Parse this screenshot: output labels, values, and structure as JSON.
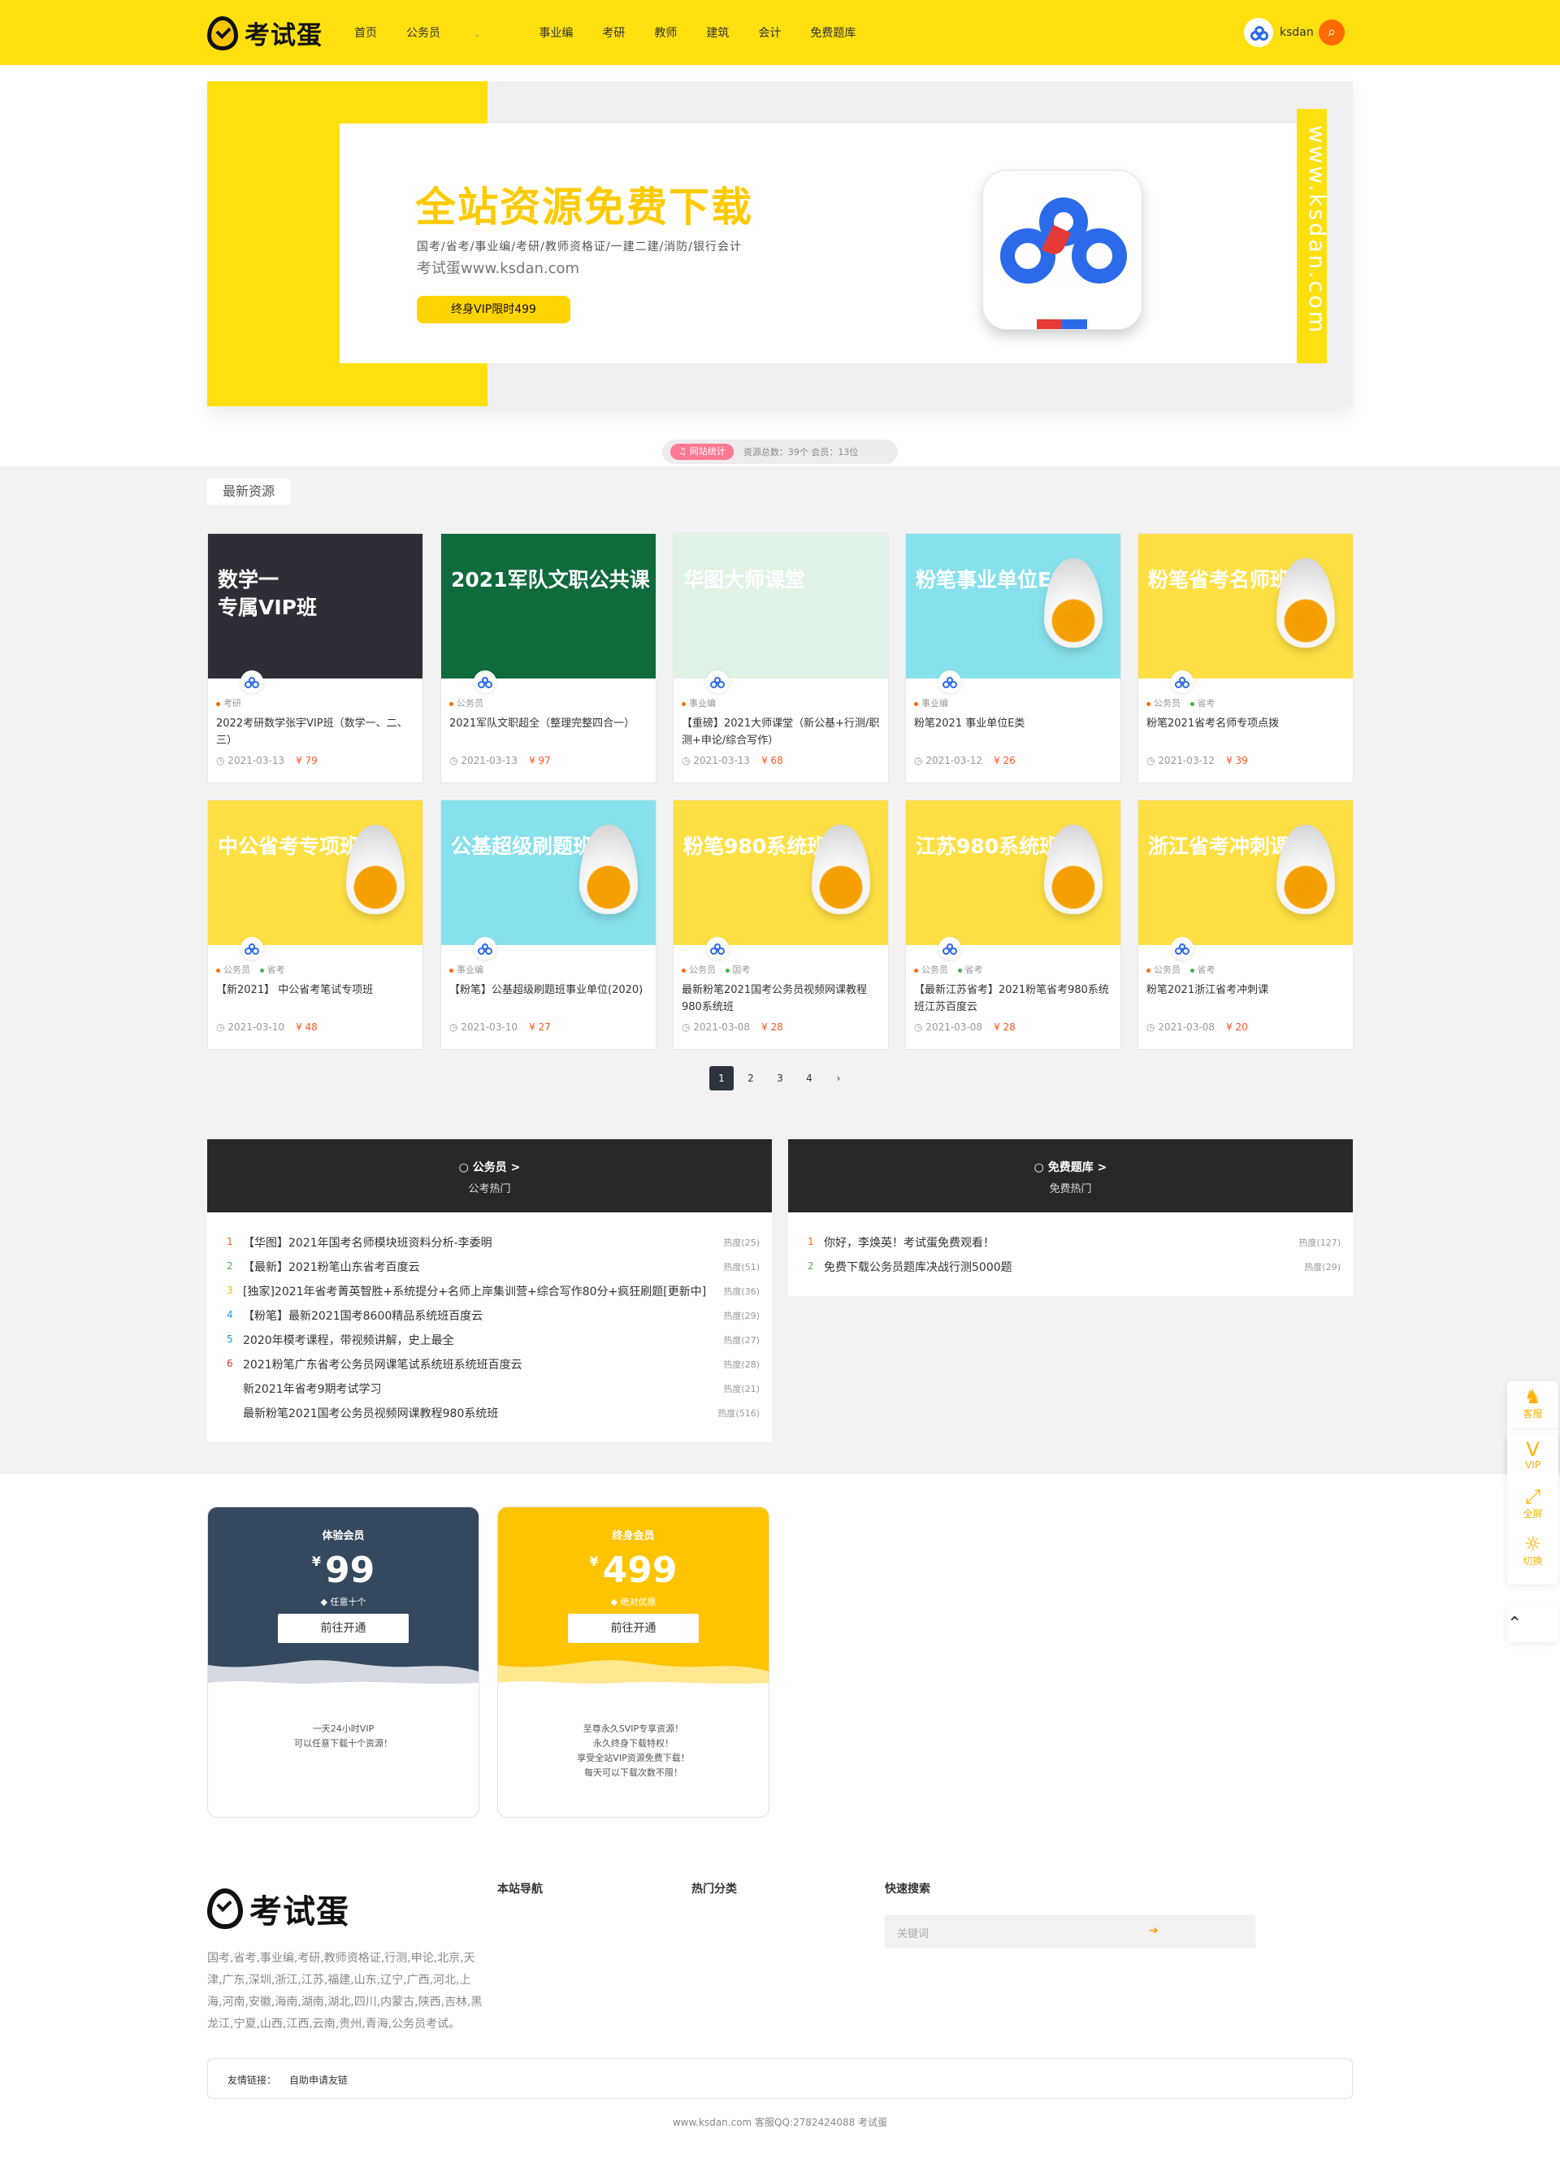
{
  "header": {
    "logo_text": "考试蛋",
    "nav": [
      "首页",
      "公务员",
      "事业编",
      "考研",
      "教师",
      "建筑",
      "会计",
      "免费题库"
    ],
    "nav_dropdown_icon": "chevron-down-icon",
    "username": "ksdan",
    "search_icon": "search-icon"
  },
  "banner": {
    "title_strong": "全站",
    "title_rest": "资源免费下载",
    "subtitle": "国考/省考/事业编/考研/教师资格证/一建二建/消防/银行会计",
    "site": "考试蛋www.ksdan.com",
    "vip_button": "终身VIP限时499",
    "vertical_text": "www.ksdan.com"
  },
  "stats": {
    "label": "网站统计",
    "text": "资源总数：39个  会员：13位"
  },
  "latest": {
    "title": "最新资源",
    "cards": [
      {
        "thumb_title": "数学一\n专属VIP班",
        "thumb_bg": "#2e2f36",
        "cat1": "考研",
        "cat2": "",
        "title": "2022考研数学张宇VIP班（数学一、二、三）",
        "date": "2021-03-13",
        "price": "¥ 79"
      },
      {
        "thumb_title": "2021军队文职公共课",
        "thumb_bg": "#0f6a3c",
        "cat1": "公务员",
        "cat2": "",
        "title": "2021军队文职超全（整理完整四合一）",
        "date": "2021-03-13",
        "price": "¥ 97"
      },
      {
        "thumb_title": "华图大师课堂",
        "thumb_bg": "#dff2e5",
        "cat1": "事业编",
        "cat2": "",
        "title": "【重磅】2021大师课堂（新公基+行测/职测+申论/综合写作）",
        "date": "2021-03-13",
        "price": "¥ 68"
      },
      {
        "thumb_title": "粉笔事业单位E类",
        "thumb_bg": "#87e1ec",
        "cat1": "事业编",
        "cat2": "",
        "title": "粉笔2021 事业单位E类",
        "date": "2021-03-12",
        "price": "¥ 26"
      },
      {
        "thumb_title": "粉笔省考名师班",
        "thumb_bg": "#ffe044",
        "cat1": "公务员",
        "cat2": "省考",
        "title": "粉笔2021省考名师专项点拨",
        "date": "2021-03-12",
        "price": "¥ 39"
      },
      {
        "thumb_title": "中公省考专项班",
        "thumb_bg": "#ffe044",
        "cat1": "公务员",
        "cat2": "省考",
        "title": "【新2021】 中公省考笔试专项班",
        "date": "2021-03-10",
        "price": "¥ 48"
      },
      {
        "thumb_title": "公基超级刷题班",
        "thumb_bg": "#87e1ec",
        "cat1": "事业编",
        "cat2": "",
        "title": "【粉笔】公基超级刷题班事业单位(2020)",
        "date": "2021-03-10",
        "price": "¥ 27"
      },
      {
        "thumb_title": "粉笔980系统班",
        "thumb_bg": "#ffe044",
        "cat1": "公务员",
        "cat2": "国考",
        "title": "最新粉笔2021国考公务员视频网课教程980系统班",
        "date": "2021-03-08",
        "price": "¥ 28"
      },
      {
        "thumb_title": "江苏980系统班",
        "thumb_bg": "#ffe044",
        "cat1": "公务员",
        "cat2": "省考",
        "title": "【最新江苏省考】2021粉笔省考980系统班江苏百度云",
        "date": "2021-03-08",
        "price": "¥ 28"
      },
      {
        "thumb_title": "浙江省考冲刺课",
        "thumb_bg": "#ffe044",
        "cat1": "公务员",
        "cat2": "省考",
        "title": "粉笔2021浙江省考冲刺课",
        "date": "2021-03-08",
        "price": "¥ 20"
      }
    ]
  },
  "pagination": [
    "1",
    "2",
    "3",
    "4",
    "›"
  ],
  "panels": [
    {
      "head": "公务员 >",
      "sub": "公考热门",
      "items": [
        {
          "num": "1",
          "title": "【华图】2021年国考名师模块班资料分析-李委明",
          "heat": "热度(25)"
        },
        {
          "num": "2",
          "title": "【最新】2021粉笔山东省考百度云",
          "heat": "热度(51)"
        },
        {
          "num": "3",
          "title": "[独家]2021年省考菁英智胜+系统提分+名师上岸集训营+综合写作80分+疯狂刷题[更新中]",
          "heat": "热度(36)"
        },
        {
          "num": "4",
          "title": "【粉笔】最新2021国考8600精品系统班百度云",
          "heat": "热度(29)"
        },
        {
          "num": "5",
          "title": "2020年模考课程，带视频讲解，史上最全",
          "heat": "热度(27)"
        },
        {
          "num": "6",
          "title": "2021粉笔广东省考公务员网课笔试系统班系统班百度云",
          "heat": "热度(28)"
        },
        {
          "num": "",
          "title": "新2021年省考9期考试学习",
          "heat": "热度(21)"
        },
        {
          "num": "",
          "title": "最新粉笔2021国考公务员视频网课教程980系统班",
          "heat": "热度(516)"
        }
      ]
    },
    {
      "head": "免费题库 >",
      "sub": "免费热门",
      "items": [
        {
          "num": "1",
          "title": "你好，李焕英！考试蛋免费观看！",
          "heat": "热度(127)"
        },
        {
          "num": "2",
          "title": "免费下载公务员题库决战行测5000题",
          "heat": "热度(29)"
        }
      ]
    }
  ],
  "vip": [
    {
      "label": "体验会员",
      "price": "99",
      "note": "任意十个",
      "button": "前往开通",
      "bg": "#34495e",
      "desc": [
        "一天24小时VIP",
        "可以任意下载十个资源！"
      ]
    },
    {
      "label": "终身会员",
      "price": "499",
      "note": "绝对优惠",
      "button": "前往开通",
      "bg": "#ffc400",
      "desc": [
        "至尊永久SVIP专享资源！",
        "永久终身下载特权！",
        "享受全站VIP资源免费下载！",
        "每天可以下载次数不限！"
      ]
    }
  ],
  "footer": {
    "logo_text": "考试蛋",
    "desc": "国考,省考,事业编,考研,教师资格证,行测,申论,北京,天津,广东,深圳,浙江,江苏,福建,山东,辽宁,广西,河北,上海,河南,安徽,海南,湖南,湖北,四川,内蒙古,陕西,吉林,黑龙江,宁夏,山西,江西,云南,贵州,青海,公务员考试。",
    "col1": "本站导航",
    "col2": "热门分类",
    "col3": "快速搜索",
    "search_placeholder": "关键词",
    "search_go_icon": "arrow-right-icon",
    "links_label": "友情链接：",
    "links_item": "自助申请友链",
    "copyright": "www.ksdan.com 客服QQ:2782424088 考试蛋"
  },
  "float_bar": {
    "items": [
      {
        "icon": "qq-icon",
        "label": "客服"
      },
      {
        "icon": "vip-icon",
        "label": "VIP"
      },
      {
        "icon": "fullscreen-icon",
        "label": "全屏"
      },
      {
        "icon": "sun-icon",
        "label": "切换"
      }
    ],
    "top_icon": "back-to-top-icon"
  },
  "colors": {
    "brand_yellow": "#ffe00f",
    "orange": "#ff6a00",
    "dark": "#282828"
  }
}
